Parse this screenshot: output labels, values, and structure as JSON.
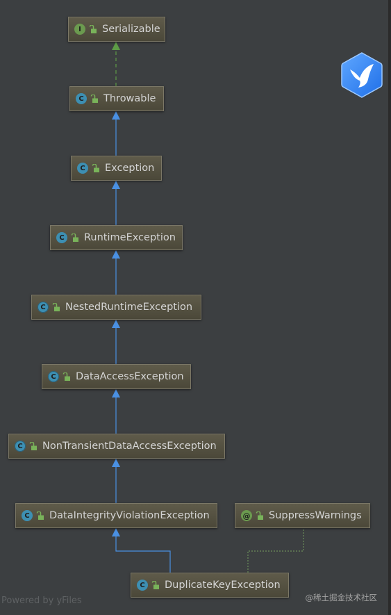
{
  "nodes": [
    {
      "id": "serializable",
      "label": "Serializable",
      "kind": "interface",
      "badge": "I"
    },
    {
      "id": "throwable",
      "label": "Throwable",
      "kind": "class",
      "badge": "C"
    },
    {
      "id": "exception",
      "label": "Exception",
      "kind": "class",
      "badge": "C"
    },
    {
      "id": "runtime-exception",
      "label": "RuntimeException",
      "kind": "class",
      "badge": "C"
    },
    {
      "id": "nested-runtime-exception",
      "label": "NestedRuntimeException",
      "kind": "abstract-class",
      "badge": "C"
    },
    {
      "id": "data-access-exception",
      "label": "DataAccessException",
      "kind": "abstract-class",
      "badge": "C"
    },
    {
      "id": "non-transient-data-access-exception",
      "label": "NonTransientDataAccessException",
      "kind": "abstract-class",
      "badge": "C"
    },
    {
      "id": "data-integrity-violation-exception",
      "label": "DataIntegrityViolationException",
      "kind": "class",
      "badge": "C"
    },
    {
      "id": "suppress-warnings",
      "label": "SuppressWarnings",
      "kind": "annotation",
      "badge": "@"
    },
    {
      "id": "duplicate-key-exception",
      "label": "DuplicateKeyException",
      "kind": "class",
      "badge": "C"
    }
  ],
  "edges": [
    {
      "from": "throwable",
      "to": "serializable",
      "type": "implements"
    },
    {
      "from": "exception",
      "to": "throwable",
      "type": "extends"
    },
    {
      "from": "runtime-exception",
      "to": "exception",
      "type": "extends"
    },
    {
      "from": "nested-runtime-exception",
      "to": "runtime-exception",
      "type": "extends"
    },
    {
      "from": "data-access-exception",
      "to": "nested-runtime-exception",
      "type": "extends"
    },
    {
      "from": "non-transient-data-access-exception",
      "to": "data-access-exception",
      "type": "extends"
    },
    {
      "from": "data-integrity-violation-exception",
      "to": "non-transient-data-access-exception",
      "type": "extends"
    },
    {
      "from": "duplicate-key-exception",
      "to": "data-integrity-violation-exception",
      "type": "extends"
    },
    {
      "from": "duplicate-key-exception",
      "to": "suppress-warnings",
      "type": "annotated-by"
    }
  ],
  "colors": {
    "background": "#3c3f41",
    "extends_edge": "#4a90e2",
    "implements_edge": "#5d9b46",
    "annotation_edge": "#6b8e5a",
    "node_text": "#d4d4d4"
  },
  "footer": {
    "text": "Powered by yFiles"
  },
  "watermark": {
    "text": "@稀土掘金技术社区"
  },
  "logo": {
    "icon": "bird-logo-icon"
  }
}
